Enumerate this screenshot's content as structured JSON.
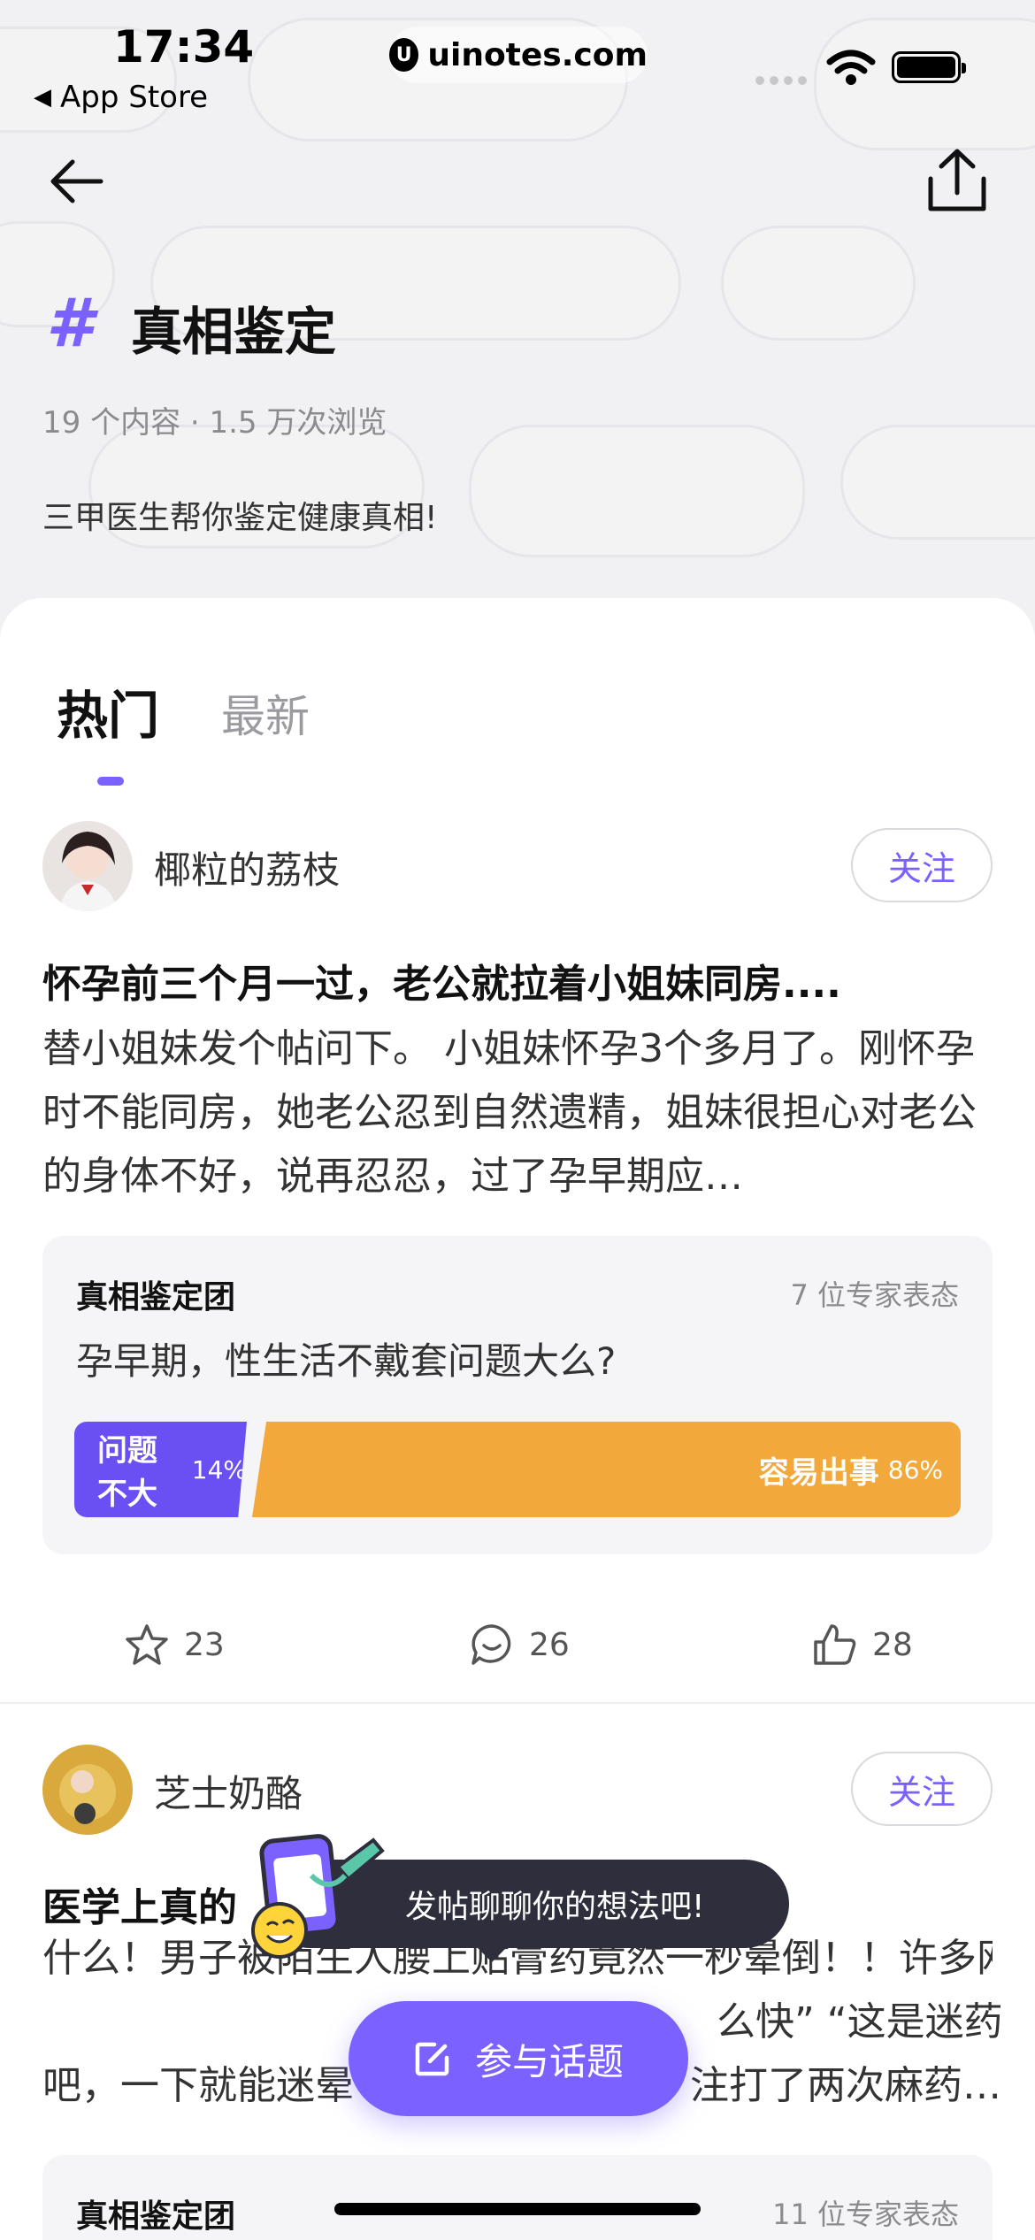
{
  "status_bar": {
    "time": "17:34",
    "back_app": "App Store",
    "url": "uinotes.com"
  },
  "topic": {
    "hash_symbol": "#",
    "title": "真相鉴定",
    "meta": "19 个内容 · 1.5 万次浏览",
    "description": "三甲医生帮你鉴定健康真相!"
  },
  "tabs": [
    {
      "label": "热门",
      "active": true
    },
    {
      "label": "最新",
      "active": false
    }
  ],
  "posts": [
    {
      "username": "椰粒的荔枝",
      "follow_label": "关注",
      "title": "怀孕前三个月一过，老公就拉着小姐妹同房....",
      "body": "替小姐妹发个帖问下。 小姐妹怀孕3个多月了。刚怀孕时不能同房，她老公忍到自然遗精，姐妹很担心对老公的身体不好，说再忍忍，过了孕早期应…",
      "vote": {
        "group": "真相鉴定团",
        "expert_count": "7 位专家表态",
        "question": "孕早期，性生活不戴套问题大么?",
        "left_label": "问题不大",
        "left_pct": "14%",
        "left_value": 14,
        "right_label": "容易出事",
        "right_pct": "86%",
        "right_value": 86
      },
      "actions": {
        "star": "23",
        "comment": "26",
        "like": "28"
      }
    },
    {
      "username": "芝士奶酪",
      "follow_label": "关注",
      "title_visible_start": "医学上真的",
      "body": "什么！男子被陌生人腰上贴膏药竟然一秒晕倒！！许多网友表示“摆",
      "body_line2_end": "么快” “这是迷药",
      "body_line3_start": "吧，一下就能迷晕",
      "body_line3_end": "注打了两次麻药…",
      "vote": {
        "group": "真相鉴定团",
        "expert_count": "11 位专家表态"
      }
    }
  ],
  "tooltip": "发帖聊聊你的想法吧!",
  "join_button": "参与话题",
  "colors": {
    "accent": "#7b61ff",
    "vote_left": "#6a4ff3",
    "vote_right": "#f2a83b",
    "tooltip_bg": "#2e2e3c"
  }
}
